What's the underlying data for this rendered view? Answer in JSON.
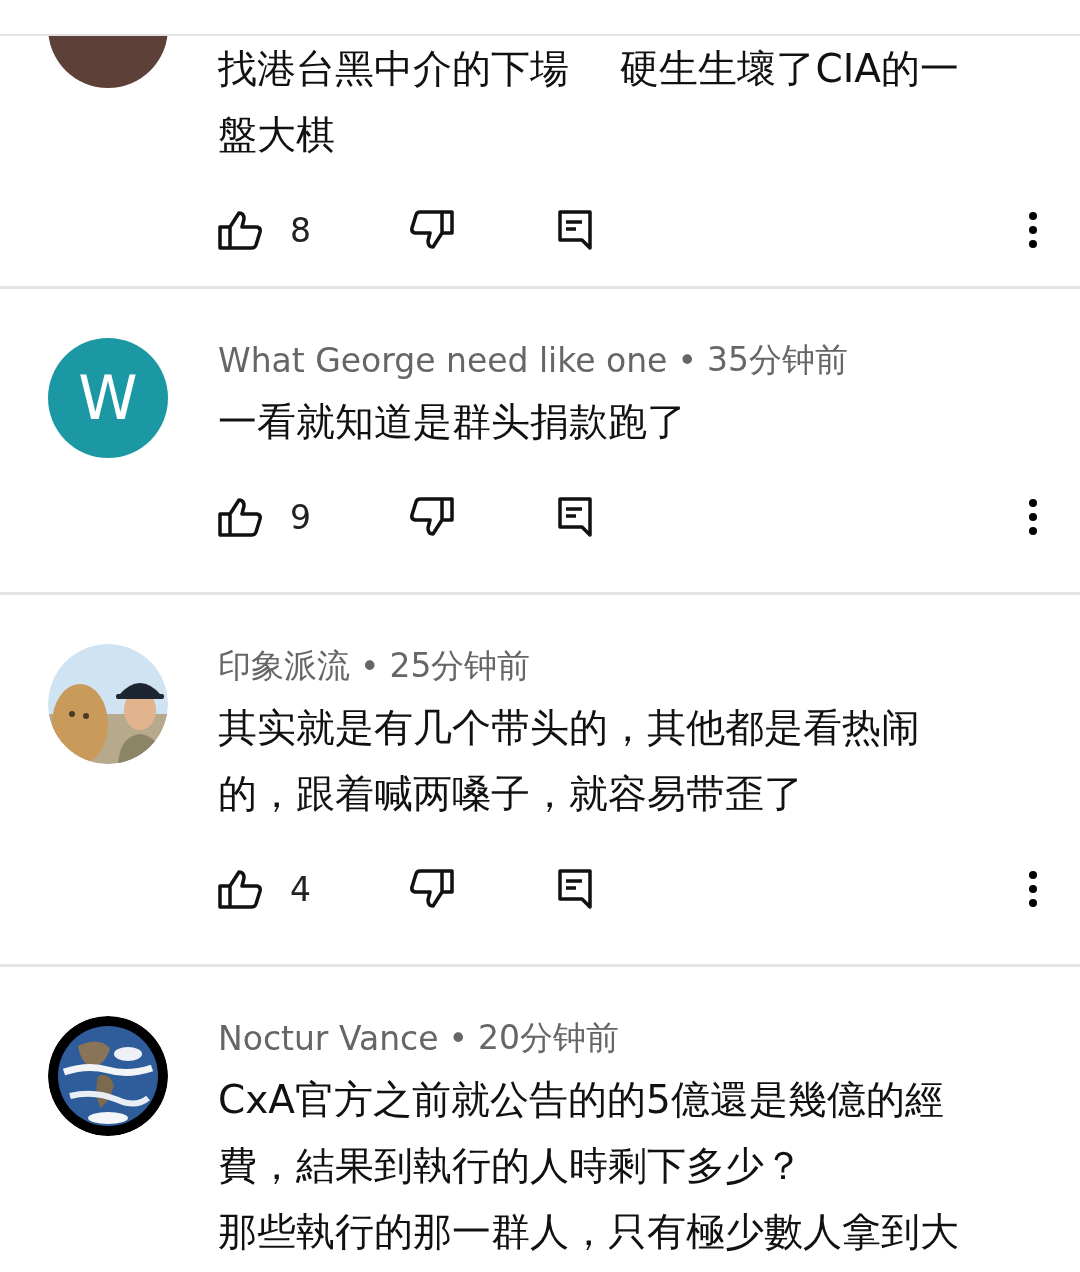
{
  "comments": [
    {
      "avatar": {
        "kind": "letter",
        "color": "#5d4037"
      },
      "lines": [
        "找港台黑中介的下場　 硬生生壞了CIA的一",
        "盤大棋"
      ],
      "likes": "8"
    },
    {
      "avatar": {
        "kind": "letter",
        "color": "#1b98a4",
        "letter": "W"
      },
      "author": "What George need like one",
      "separator": "•",
      "time": "35分钟前",
      "lines": [
        "一看就知道是群头捐款跑了"
      ],
      "likes": "9"
    },
    {
      "avatar": {
        "kind": "picture"
      },
      "author": "印象派流",
      "separator": "•",
      "time": "25分钟前",
      "lines": [
        "其实就是有几个带头的，其他都是看热闹",
        "的，跟着喊两嗓子，就容易带歪了"
      ],
      "likes": "4"
    },
    {
      "avatar": {
        "kind": "picture"
      },
      "author": "Noctur Vance",
      "separator": "•",
      "time": "20分钟前",
      "lines": [
        "CxA官方之前就公告的的5億還是幾億的經",
        "費，結果到執行的人時剩下多少？",
        "那些執行的那一群人，只有極少數人拿到大"
      ]
    }
  ]
}
